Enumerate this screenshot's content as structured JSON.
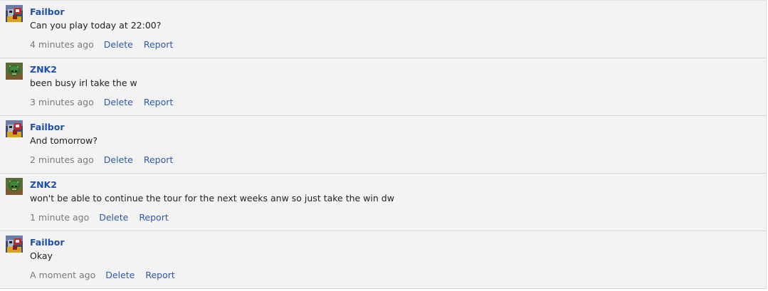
{
  "comments": [
    {
      "author": "Failbor",
      "avatar": "failbor-avatar",
      "text": "Can you play today at 22:00?",
      "time": "4 minutes ago",
      "delete_label": "Delete",
      "report_label": "Report"
    },
    {
      "author": "ZNK2",
      "avatar": "znk2-avatar",
      "text": "been busy irl take the w",
      "time": "3 minutes ago",
      "delete_label": "Delete",
      "report_label": "Report"
    },
    {
      "author": "Failbor",
      "avatar": "failbor-avatar",
      "text": "And tomorrow?",
      "time": "2 minutes ago",
      "delete_label": "Delete",
      "report_label": "Report"
    },
    {
      "author": "ZNK2",
      "avatar": "znk2-avatar",
      "text": "won't be able to continue the tour for the next weeks anw so just take the win dw",
      "time": "1 minute ago",
      "delete_label": "Delete",
      "report_label": "Report"
    },
    {
      "author": "Failbor",
      "avatar": "failbor-avatar",
      "text": "Okay",
      "time": "A moment ago",
      "delete_label": "Delete",
      "report_label": "Report"
    }
  ],
  "colors": {
    "background": "#f3f3f3",
    "author": "#1f4fae",
    "link": "#2d5aa8",
    "muted": "#7a7a7a",
    "text": "#222222"
  }
}
